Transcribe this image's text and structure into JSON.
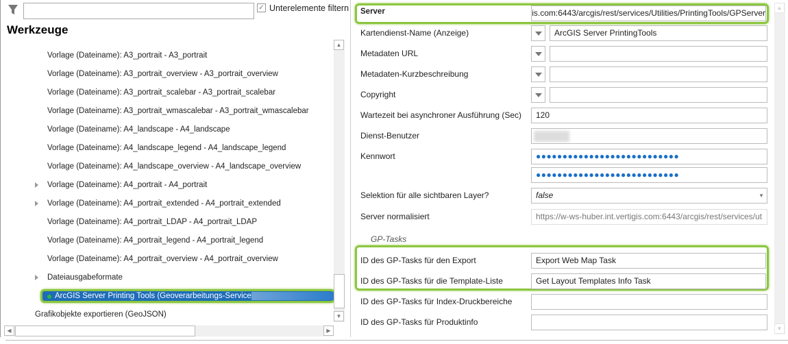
{
  "filter": {
    "placeholder": "",
    "checkbox_label": "Unterelemente filtern",
    "checked": true
  },
  "tree": {
    "title": "Werkzeuge",
    "items": [
      {
        "label": "Vorlage (Dateiname): A3_portrait - A3_portrait",
        "expandable": false
      },
      {
        "label": "Vorlage (Dateiname): A3_portrait_overview - A3_portrait_overview",
        "expandable": false
      },
      {
        "label": "Vorlage (Dateiname): A3_portrait_scalebar - A3_portrait_scalebar",
        "expandable": false
      },
      {
        "label": "Vorlage (Dateiname): A3_portrait_wmascalebar - A3_portrait_wmascalebar",
        "expandable": false
      },
      {
        "label": "Vorlage (Dateiname): A4_landscape - A4_landscape",
        "expandable": false
      },
      {
        "label": "Vorlage (Dateiname): A4_landscape_legend - A4_landscape_legend",
        "expandable": false
      },
      {
        "label": "Vorlage (Dateiname): A4_landscape_overview - A4_landscape_overview",
        "expandable": false
      },
      {
        "label": "Vorlage (Dateiname): A4_portrait - A4_portrait",
        "expandable": true
      },
      {
        "label": "Vorlage (Dateiname): A4_portrait_extended - A4_portrait_extended",
        "expandable": true
      },
      {
        "label": "Vorlage (Dateiname): A4_portrait_LDAP - A4_portrait_LDAP",
        "expandable": false
      },
      {
        "label": "Vorlage (Dateiname): A4_portrait_legend - A4_portrait_legend",
        "expandable": false
      },
      {
        "label": "Vorlage (Dateiname): A4_portrait_overview - A4_portrait_overview",
        "expandable": false
      },
      {
        "label": "Dateiausgabeformate",
        "expandable": true
      }
    ],
    "selected": "ArcGIS Server Printing Tools (Geoverarbeitungs-Service):",
    "last": "Grafikobjekte exportieren (GeoJSON)"
  },
  "props": {
    "server": {
      "label": "Server",
      "value": "is.com:6443/arcgis/rest/services/Utilities/PrintingTools/GPServer"
    },
    "kartendienst": {
      "label": "Kartendienst-Name (Anzeige)",
      "value": "ArcGIS Server PrintingTools"
    },
    "metadaten_url": {
      "label": "Metadaten URL",
      "value": ""
    },
    "metadaten_kurz": {
      "label": "Metadaten-Kurzbeschreibung",
      "value": ""
    },
    "copyright": {
      "label": "Copyright",
      "value": ""
    },
    "wartezeit": {
      "label": "Wartezeit bei asynchroner Ausführung (Sec)",
      "value": "120"
    },
    "benutzer": {
      "label": "Dienst-Benutzer",
      "value": ""
    },
    "kennwort": {
      "label": "Kennwort",
      "value": "●●●●●●●●●●●●●●●●●●●●●●●●●●●",
      "confirm": "●●●●●●●●●●●●●●●●●●●●●●●●●●●"
    },
    "selektion": {
      "label": "Selektion für alle sichtbaren Layer?",
      "value": "false"
    },
    "normalisiert": {
      "label": "Server normalisiert",
      "value": "https://w-ws-huber.int.vertigis.com:6443/arcgis/rest/services/ut"
    },
    "gp_section": "GP-Tasks",
    "export": {
      "label": "ID des GP-Tasks für den Export",
      "value": "Export Web Map Task"
    },
    "template": {
      "label": "ID des GP-Tasks für die Template-Liste",
      "value": "Get Layout Templates Info Task"
    },
    "index": {
      "label": "ID des GP-Tasks für Index-Druckbereiche",
      "value": ""
    },
    "produkt": {
      "label": "ID des GP-Tasks für Produktinfo",
      "value": ""
    }
  },
  "colors": {
    "highlight": "#8cc63f",
    "selection": "#1e6cb8",
    "password_dots": "#1a6fc7"
  }
}
